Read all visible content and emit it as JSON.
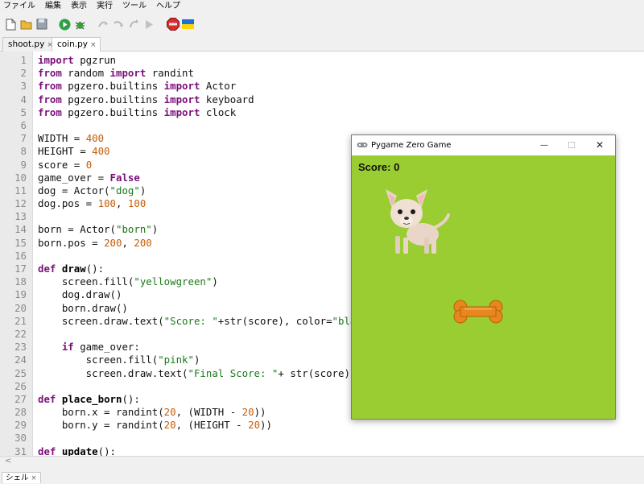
{
  "menu": [
    "ファイル",
    "編集",
    "表示",
    "実行",
    "ツール",
    "ヘルプ"
  ],
  "tabs": [
    {
      "label": "shoot.py",
      "close": "×"
    },
    {
      "label": "coin.py",
      "close": "×"
    }
  ],
  "code": [
    [
      [
        "kw",
        "import"
      ],
      [
        "t",
        " pgzrun"
      ]
    ],
    [
      [
        "kw",
        "from"
      ],
      [
        "t",
        " random "
      ],
      [
        "kw",
        "import"
      ],
      [
        "t",
        " randint"
      ]
    ],
    [
      [
        "kw",
        "from"
      ],
      [
        "t",
        " pgzero.builtins "
      ],
      [
        "kw",
        "import"
      ],
      [
        "t",
        " Actor"
      ]
    ],
    [
      [
        "kw",
        "from"
      ],
      [
        "t",
        " pgzero.builtins "
      ],
      [
        "kw",
        "import"
      ],
      [
        "t",
        " keyboard"
      ]
    ],
    [
      [
        "kw",
        "from"
      ],
      [
        "t",
        " pgzero.builtins "
      ],
      [
        "kw",
        "import"
      ],
      [
        "t",
        " clock"
      ]
    ],
    [],
    [
      [
        "t",
        "WIDTH = "
      ],
      [
        "num",
        "400"
      ]
    ],
    [
      [
        "t",
        "HEIGHT = "
      ],
      [
        "num",
        "400"
      ]
    ],
    [
      [
        "t",
        "score = "
      ],
      [
        "num",
        "0"
      ]
    ],
    [
      [
        "t",
        "game_over = "
      ],
      [
        "kw",
        "False"
      ]
    ],
    [
      [
        "t",
        "dog = Actor("
      ],
      [
        "str",
        "\"dog\""
      ],
      [
        "t",
        ")"
      ]
    ],
    [
      [
        "t",
        "dog.pos = "
      ],
      [
        "num",
        "100"
      ],
      [
        "t",
        ", "
      ],
      [
        "num",
        "100"
      ]
    ],
    [],
    [
      [
        "t",
        "born = Actor("
      ],
      [
        "str",
        "\"born\""
      ],
      [
        "t",
        ")"
      ]
    ],
    [
      [
        "t",
        "born.pos = "
      ],
      [
        "num",
        "200"
      ],
      [
        "t",
        ", "
      ],
      [
        "num",
        "200"
      ]
    ],
    [],
    [
      [
        "kw",
        "def"
      ],
      [
        "t",
        " "
      ],
      [
        "fn",
        "draw"
      ],
      [
        "t",
        "():"
      ]
    ],
    [
      [
        "t",
        "    screen.fill("
      ],
      [
        "str",
        "\"yellowgreen\""
      ],
      [
        "t",
        ")"
      ]
    ],
    [
      [
        "t",
        "    dog.draw()"
      ]
    ],
    [
      [
        "t",
        "    born.draw()"
      ]
    ],
    [
      [
        "t",
        "    screen.draw.text("
      ],
      [
        "str",
        "\"Score: \""
      ],
      [
        "t",
        "+str(score), color="
      ],
      [
        "str",
        "\"bla"
      ]
    ],
    [],
    [
      [
        "t",
        "    "
      ],
      [
        "kw",
        "if"
      ],
      [
        "t",
        " game_over:"
      ]
    ],
    [
      [
        "t",
        "        screen.fill("
      ],
      [
        "str",
        "\"pink\""
      ],
      [
        "t",
        ")"
      ]
    ],
    [
      [
        "t",
        "        screen.draw.text("
      ],
      [
        "str",
        "\"Final Score: \""
      ],
      [
        "t",
        "+ str(score),"
      ]
    ],
    [],
    [
      [
        "kw",
        "def"
      ],
      [
        "t",
        " "
      ],
      [
        "fn",
        "place_born"
      ],
      [
        "t",
        "():"
      ]
    ],
    [
      [
        "t",
        "    born.x = randint("
      ],
      [
        "num",
        "20"
      ],
      [
        "t",
        ", (WIDTH - "
      ],
      [
        "num",
        "20"
      ],
      [
        "t",
        "))"
      ]
    ],
    [
      [
        "t",
        "    born.y = randint("
      ],
      [
        "num",
        "20"
      ],
      [
        "t",
        ", (HEIGHT - "
      ],
      [
        "num",
        "20"
      ],
      [
        "t",
        "))"
      ]
    ],
    [],
    [
      [
        "kw",
        "def"
      ],
      [
        "t",
        " "
      ],
      [
        "fn",
        "update"
      ],
      [
        "t",
        "():"
      ]
    ]
  ],
  "bottom": {
    "scroll_left": "<",
    "shell_tab": "シェル",
    "shell_close": "×"
  },
  "game_window": {
    "title": "Pygame Zero Game",
    "minimize": "—",
    "maximize": "☐",
    "close": "✕",
    "score_text": "Score: 0",
    "bg_color": "#9acd32"
  },
  "colors": {
    "keyword": "#7a0f7a",
    "string": "#1a7a1a",
    "number": "#c65d09"
  }
}
